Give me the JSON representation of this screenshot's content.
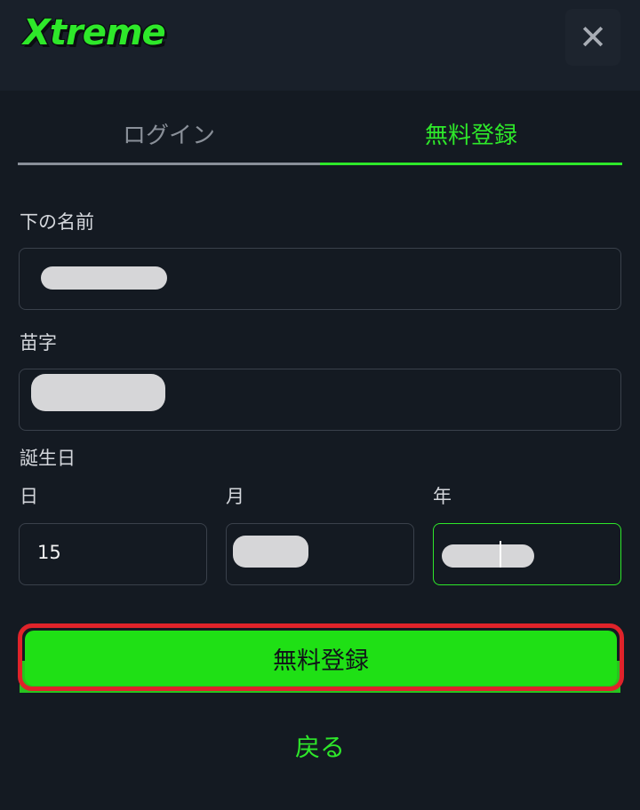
{
  "header": {
    "logo_text": "Xtreme",
    "close_icon": "close-icon"
  },
  "tabs": [
    {
      "label": "ログイン",
      "active": false
    },
    {
      "label": "無料登録",
      "active": true
    }
  ],
  "form": {
    "first_name": {
      "label": "下の名前",
      "value_redacted": true
    },
    "last_name": {
      "label": "苗字",
      "value_redacted": true
    },
    "birthdate": {
      "label": "誕生日",
      "day": {
        "label": "日",
        "value": "15"
      },
      "month": {
        "label": "月",
        "value_redacted": true
      },
      "year": {
        "label": "年",
        "value_redacted": true,
        "focused": true
      }
    }
  },
  "actions": {
    "submit_label": "無料登録",
    "back_label": "戻る"
  },
  "colors": {
    "accent": "#2ee82a",
    "button": "#1fe015",
    "highlight_border": "#e0232a",
    "background": "#141a22"
  }
}
